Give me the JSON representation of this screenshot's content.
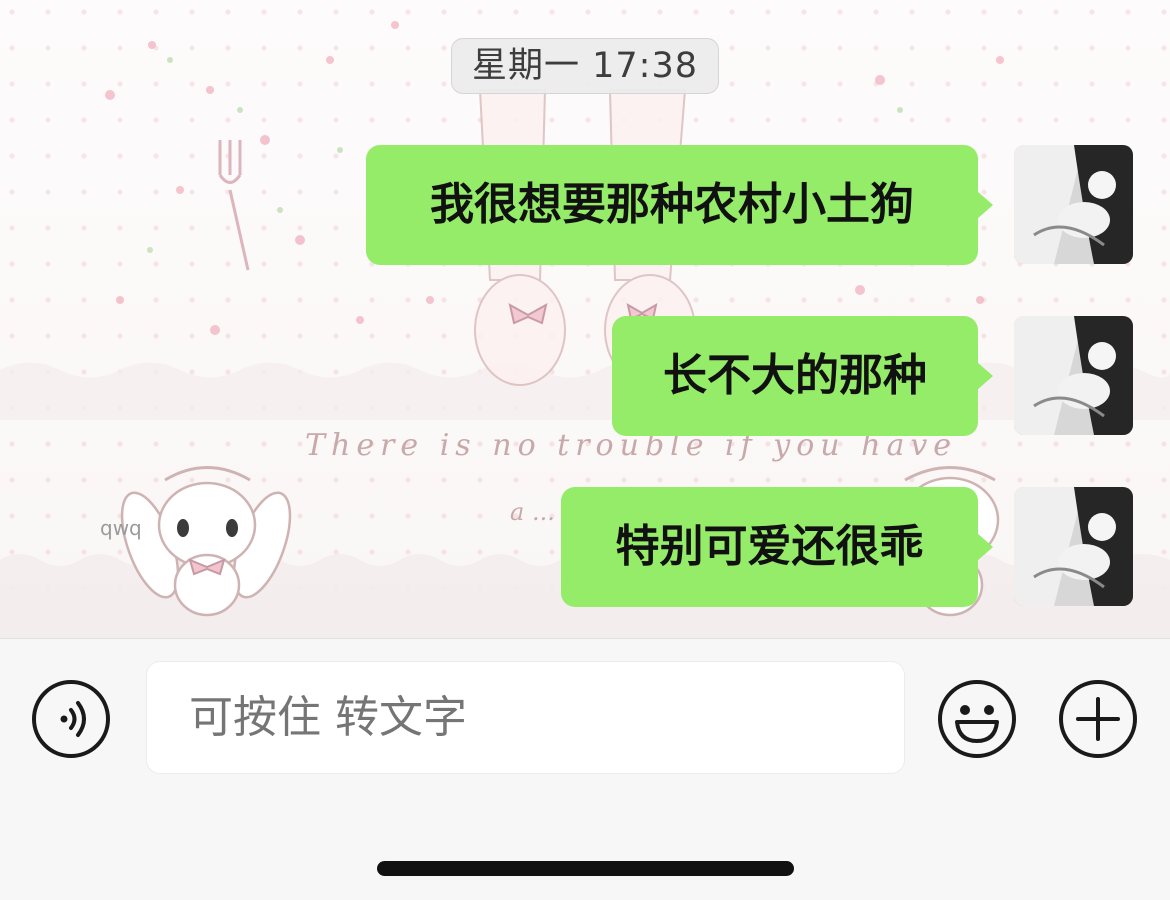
{
  "timestamp": "星期一 17:38",
  "messages": [
    {
      "text": "我很想要那种农村小土狗",
      "sender": "me"
    },
    {
      "text": "长不大的那种",
      "sender": "me"
    },
    {
      "text": "特别可爱还很乖",
      "sender": "me"
    }
  ],
  "wallpaper": {
    "caption_line1": "There is no trouble if you have",
    "caption_line2": "a ...",
    "watermark": "qwq"
  },
  "input": {
    "placeholder": "可按住 转文字"
  },
  "icons": {
    "voice": "voice-waves-icon",
    "emoji": "emoji-smile-icon",
    "plus": "plus-circle-icon"
  },
  "colors": {
    "bubble_green": "#95ec69",
    "background": "#fbf8f8",
    "input_bar": "#f7f7f7"
  }
}
